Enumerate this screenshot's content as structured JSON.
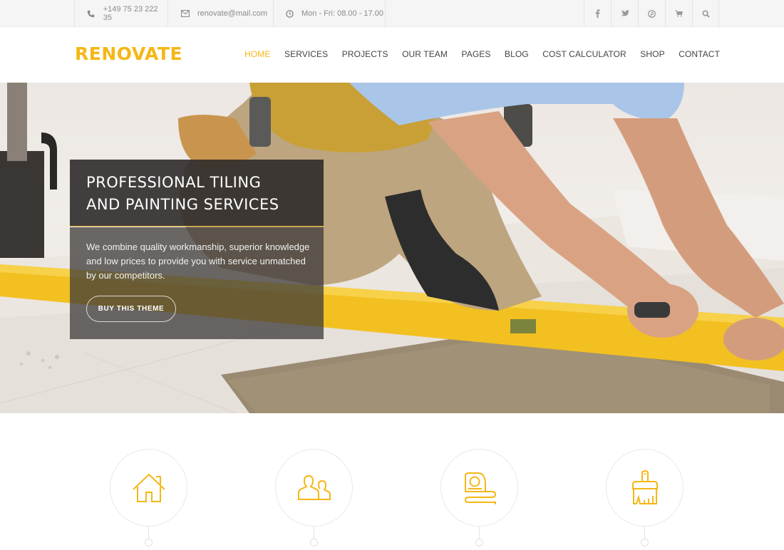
{
  "topbar": {
    "phone": "+149 75 23 222 35",
    "email": "renovate@mail.com",
    "hours": "Mon - Fri: 08.00 - 17.00",
    "icons": [
      "phone-icon",
      "envelope-icon",
      "clock-icon"
    ],
    "social": [
      "facebook-icon",
      "twitter-icon",
      "pinterest-icon",
      "cart-icon",
      "search-icon"
    ]
  },
  "header": {
    "logo": "RENOVATE",
    "nav": [
      {
        "label": "HOME",
        "active": true
      },
      {
        "label": "SERVICES",
        "active": false
      },
      {
        "label": "PROJECTS",
        "active": false
      },
      {
        "label": "OUR TEAM",
        "active": false
      },
      {
        "label": "PAGES",
        "active": false
      },
      {
        "label": "BLOG",
        "active": false
      },
      {
        "label": "COST CALCULATOR",
        "active": false
      },
      {
        "label": "SHOP",
        "active": false
      },
      {
        "label": "CONTACT",
        "active": false
      }
    ]
  },
  "hero": {
    "title_line1": "PROFESSIONAL TILING",
    "title_line2": "AND PAINTING SERVICES",
    "description": "We combine quality workmanship, superior knowledge and low prices to provide you with service unmatched by our competitors.",
    "button_label": "BUY THIS THEME"
  },
  "features": [
    {
      "icon": "house-icon"
    },
    {
      "icon": "team-icon"
    },
    {
      "icon": "tape-measure-icon"
    },
    {
      "icon": "paint-brush-icon"
    }
  ],
  "colors": {
    "accent": "#f5b716",
    "topbar_bg": "#f5f5f5",
    "text": "#444444"
  }
}
